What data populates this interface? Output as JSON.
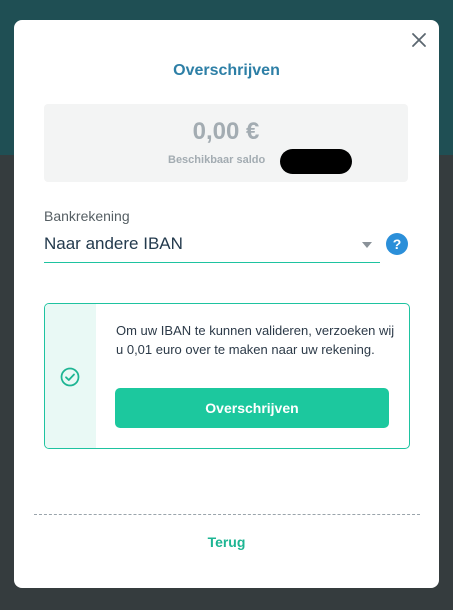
{
  "modal": {
    "title": "Overschrijven",
    "close_icon": "close-icon"
  },
  "balance": {
    "amount": "0,00 €",
    "label": "Beschikbaar saldo"
  },
  "account_select": {
    "label": "Bankrekening",
    "value": "Naar andere IBAN",
    "help": "?"
  },
  "info": {
    "text": "Om uw IBAN te kunnen valideren, verzoeken wij u 0,01 euro over te maken naar uw rekening.",
    "button_label": "Overschrijven",
    "icon": "check-circle-icon"
  },
  "footer": {
    "back_label": "Terug"
  },
  "colors": {
    "accent": "#1cc89e",
    "title": "#2d7fa6",
    "help": "#2b8fd9"
  }
}
